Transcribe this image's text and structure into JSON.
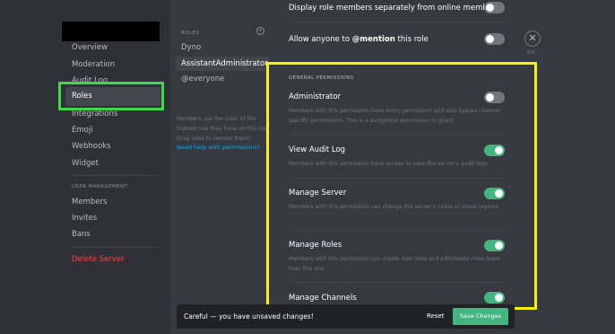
{
  "sidebar": {
    "items": [
      {
        "label": "Overview"
      },
      {
        "label": "Moderation"
      },
      {
        "label": "Audit Log"
      },
      {
        "label": "Roles"
      },
      {
        "label": "Integrations"
      },
      {
        "label": "Emoji"
      },
      {
        "label": "Webhooks"
      },
      {
        "label": "Widget"
      }
    ],
    "user_management_heading": "USER MANAGEMENT",
    "user_items": [
      {
        "label": "Members"
      },
      {
        "label": "Invites"
      },
      {
        "label": "Bans"
      }
    ],
    "delete_label": "Delete Server"
  },
  "roles": {
    "heading": "ROLES",
    "add_symbol": "+",
    "items": [
      {
        "label": "Dyno"
      },
      {
        "label": "AssistantAdministrator"
      },
      {
        "label": "@everyone"
      }
    ],
    "help_text": "Members use the color of the highest role they have on this list. Drag roles to reorder them!",
    "help_link": "Need help with permissions?"
  },
  "settings": {
    "display_separately": {
      "label": "Display role members separately from online members",
      "enabled": false
    },
    "allow_mention": {
      "label_prefix": "Allow anyone to ",
      "label_bold": "@mention",
      "label_suffix": " this role",
      "enabled": false
    },
    "section_heading": "GENERAL PERMISSIONS",
    "permissions": [
      {
        "label": "Administrator",
        "description": "Members with this permission have every permission and also bypass channel specific permissions. This is a dangerous permission to grant.",
        "enabled": false
      },
      {
        "label": "View Audit Log",
        "description": "Members with this permission have access to view the server's audit logs",
        "enabled": true
      },
      {
        "label": "Manage Server",
        "description": "Members with this permission can change the server's name or move regions.",
        "enabled": true
      },
      {
        "label": "Manage Roles",
        "description": "Members with this permission can create new roles and edit/delete roles lower than this one.",
        "enabled": true
      },
      {
        "label": "Manage Channels",
        "description": "",
        "enabled": true
      }
    ]
  },
  "close": {
    "symbol": "✕",
    "label": "ESC"
  },
  "notice": {
    "text": "Careful — you have unsaved changes!",
    "reset_label": "Reset",
    "save_label": "Save Changes"
  },
  "colors": {
    "accent_green": "#43b581",
    "highlight_green": "#3fd84a",
    "highlight_yellow": "#fff200",
    "danger": "#f04747",
    "link": "#00b0f4"
  }
}
